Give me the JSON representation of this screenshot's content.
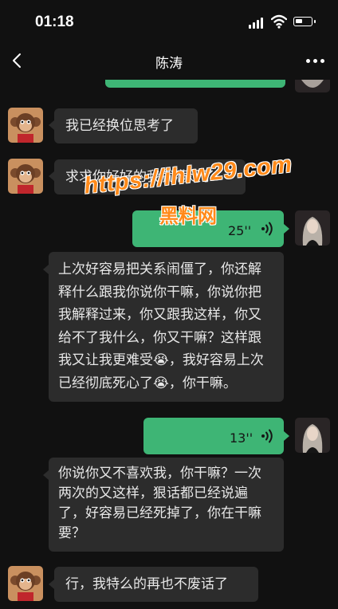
{
  "status_bar": {
    "time": "01:18"
  },
  "header": {
    "title": "陈涛"
  },
  "messages": [
    {
      "side": "in",
      "type": "text",
      "text": "我已经换位思考了"
    },
    {
      "side": "in",
      "type": "text",
      "text": "求求你好好的我就满足了"
    },
    {
      "side": "out",
      "type": "voice",
      "duration": "25''"
    },
    {
      "side": "in",
      "type": "text",
      "text": "上次好容易把关系闹僵了，你还解释什么跟我你说你干嘛，你说你把我解释过来，你又跟我这样，你又给不了我什么，你又干嘛？这样跟我又让我更难受😭，我好容易上次已经彻底死心了😭，你干嘛。"
    },
    {
      "side": "out",
      "type": "voice",
      "duration": "13''"
    },
    {
      "side": "in",
      "type": "text",
      "text": "你说你又不喜欢我，你干嘛？一次两次的又这样，狠话都已经说遍了，好容易已经死掉了，你在干嘛要？"
    },
    {
      "side": "in",
      "type": "text",
      "text": "行，我特么的再也不废话了"
    }
  ],
  "watermark": {
    "url": "https://ihlw29.com",
    "name": "黑料网"
  },
  "colors": {
    "background": "#111111",
    "incoming_bubble": "#2c2c2c",
    "outgoing_bubble": "#3eb575",
    "watermark": "#ff8a1a"
  }
}
